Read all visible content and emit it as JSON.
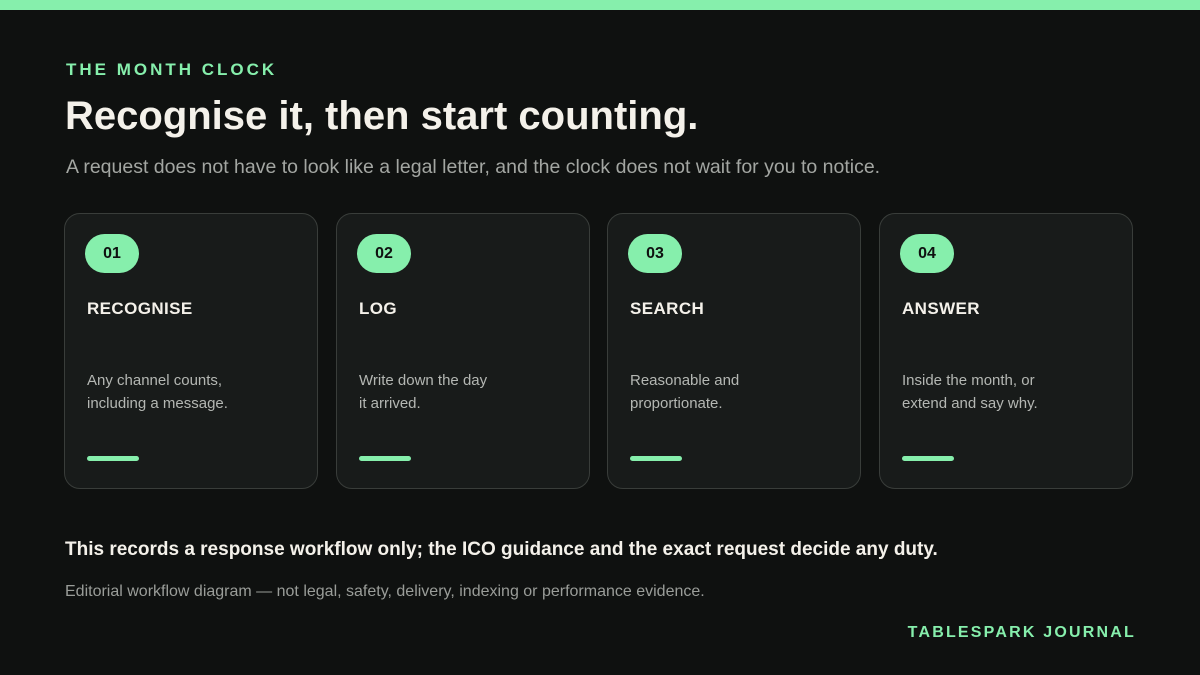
{
  "eyebrow": "THE MONTH CLOCK",
  "title": "Recognise it, then start counting.",
  "subtitle": "A request does not have to look like a legal letter, and the clock does not wait for you to notice.",
  "steps": [
    {
      "number": "01",
      "title": "RECOGNISE",
      "description": "Any channel counts,\nincluding a message."
    },
    {
      "number": "02",
      "title": "LOG",
      "description": "Write down the day\nit arrived."
    },
    {
      "number": "03",
      "title": "SEARCH",
      "description": "Reasonable and\nproportionate."
    },
    {
      "number": "04",
      "title": "ANSWER",
      "description": "Inside the month, or\nextend and say why."
    }
  ],
  "note": "This records a response workflow only; the ICO guidance and the exact request decide any duty.",
  "disclaimer": "Editorial workflow diagram — not legal, safety, delivery, indexing or performance evidence.",
  "brand": "TABLESPARK JOURNAL",
  "colors": {
    "background": "#0f1110",
    "accent": "#86efac",
    "card": "#181b1a",
    "card_border": "#393d3a"
  }
}
